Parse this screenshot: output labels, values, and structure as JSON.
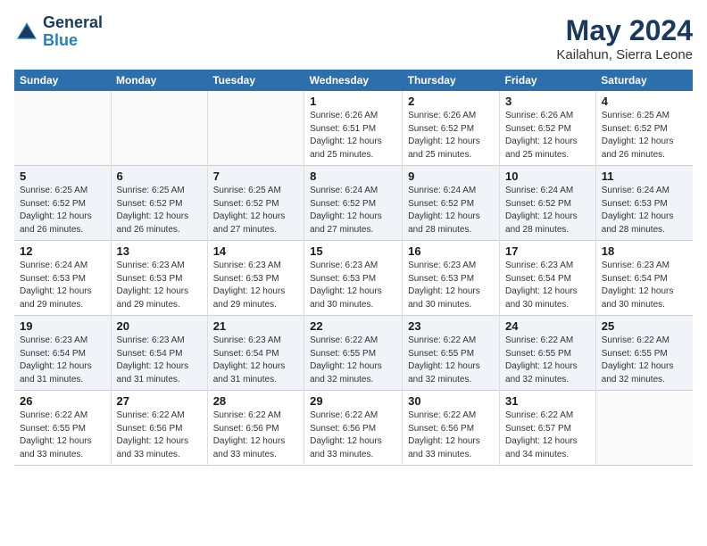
{
  "header": {
    "logo_line1": "General",
    "logo_line2": "Blue",
    "month": "May 2024",
    "location": "Kailahun, Sierra Leone"
  },
  "weekdays": [
    "Sunday",
    "Monday",
    "Tuesday",
    "Wednesday",
    "Thursday",
    "Friday",
    "Saturday"
  ],
  "weeks": [
    [
      {
        "day": "",
        "sunrise": "",
        "sunset": "",
        "daylight": ""
      },
      {
        "day": "",
        "sunrise": "",
        "sunset": "",
        "daylight": ""
      },
      {
        "day": "",
        "sunrise": "",
        "sunset": "",
        "daylight": ""
      },
      {
        "day": "1",
        "sunrise": "Sunrise: 6:26 AM",
        "sunset": "Sunset: 6:51 PM",
        "daylight": "Daylight: 12 hours and 25 minutes."
      },
      {
        "day": "2",
        "sunrise": "Sunrise: 6:26 AM",
        "sunset": "Sunset: 6:52 PM",
        "daylight": "Daylight: 12 hours and 25 minutes."
      },
      {
        "day": "3",
        "sunrise": "Sunrise: 6:26 AM",
        "sunset": "Sunset: 6:52 PM",
        "daylight": "Daylight: 12 hours and 25 minutes."
      },
      {
        "day": "4",
        "sunrise": "Sunrise: 6:25 AM",
        "sunset": "Sunset: 6:52 PM",
        "daylight": "Daylight: 12 hours and 26 minutes."
      }
    ],
    [
      {
        "day": "5",
        "sunrise": "Sunrise: 6:25 AM",
        "sunset": "Sunset: 6:52 PM",
        "daylight": "Daylight: 12 hours and 26 minutes."
      },
      {
        "day": "6",
        "sunrise": "Sunrise: 6:25 AM",
        "sunset": "Sunset: 6:52 PM",
        "daylight": "Daylight: 12 hours and 26 minutes."
      },
      {
        "day": "7",
        "sunrise": "Sunrise: 6:25 AM",
        "sunset": "Sunset: 6:52 PM",
        "daylight": "Daylight: 12 hours and 27 minutes."
      },
      {
        "day": "8",
        "sunrise": "Sunrise: 6:24 AM",
        "sunset": "Sunset: 6:52 PM",
        "daylight": "Daylight: 12 hours and 27 minutes."
      },
      {
        "day": "9",
        "sunrise": "Sunrise: 6:24 AM",
        "sunset": "Sunset: 6:52 PM",
        "daylight": "Daylight: 12 hours and 28 minutes."
      },
      {
        "day": "10",
        "sunrise": "Sunrise: 6:24 AM",
        "sunset": "Sunset: 6:52 PM",
        "daylight": "Daylight: 12 hours and 28 minutes."
      },
      {
        "day": "11",
        "sunrise": "Sunrise: 6:24 AM",
        "sunset": "Sunset: 6:53 PM",
        "daylight": "Daylight: 12 hours and 28 minutes."
      }
    ],
    [
      {
        "day": "12",
        "sunrise": "Sunrise: 6:24 AM",
        "sunset": "Sunset: 6:53 PM",
        "daylight": "Daylight: 12 hours and 29 minutes."
      },
      {
        "day": "13",
        "sunrise": "Sunrise: 6:23 AM",
        "sunset": "Sunset: 6:53 PM",
        "daylight": "Daylight: 12 hours and 29 minutes."
      },
      {
        "day": "14",
        "sunrise": "Sunrise: 6:23 AM",
        "sunset": "Sunset: 6:53 PM",
        "daylight": "Daylight: 12 hours and 29 minutes."
      },
      {
        "day": "15",
        "sunrise": "Sunrise: 6:23 AM",
        "sunset": "Sunset: 6:53 PM",
        "daylight": "Daylight: 12 hours and 30 minutes."
      },
      {
        "day": "16",
        "sunrise": "Sunrise: 6:23 AM",
        "sunset": "Sunset: 6:53 PM",
        "daylight": "Daylight: 12 hours and 30 minutes."
      },
      {
        "day": "17",
        "sunrise": "Sunrise: 6:23 AM",
        "sunset": "Sunset: 6:54 PM",
        "daylight": "Daylight: 12 hours and 30 minutes."
      },
      {
        "day": "18",
        "sunrise": "Sunrise: 6:23 AM",
        "sunset": "Sunset: 6:54 PM",
        "daylight": "Daylight: 12 hours and 30 minutes."
      }
    ],
    [
      {
        "day": "19",
        "sunrise": "Sunrise: 6:23 AM",
        "sunset": "Sunset: 6:54 PM",
        "daylight": "Daylight: 12 hours and 31 minutes."
      },
      {
        "day": "20",
        "sunrise": "Sunrise: 6:23 AM",
        "sunset": "Sunset: 6:54 PM",
        "daylight": "Daylight: 12 hours and 31 minutes."
      },
      {
        "day": "21",
        "sunrise": "Sunrise: 6:23 AM",
        "sunset": "Sunset: 6:54 PM",
        "daylight": "Daylight: 12 hours and 31 minutes."
      },
      {
        "day": "22",
        "sunrise": "Sunrise: 6:22 AM",
        "sunset": "Sunset: 6:55 PM",
        "daylight": "Daylight: 12 hours and 32 minutes."
      },
      {
        "day": "23",
        "sunrise": "Sunrise: 6:22 AM",
        "sunset": "Sunset: 6:55 PM",
        "daylight": "Daylight: 12 hours and 32 minutes."
      },
      {
        "day": "24",
        "sunrise": "Sunrise: 6:22 AM",
        "sunset": "Sunset: 6:55 PM",
        "daylight": "Daylight: 12 hours and 32 minutes."
      },
      {
        "day": "25",
        "sunrise": "Sunrise: 6:22 AM",
        "sunset": "Sunset: 6:55 PM",
        "daylight": "Daylight: 12 hours and 32 minutes."
      }
    ],
    [
      {
        "day": "26",
        "sunrise": "Sunrise: 6:22 AM",
        "sunset": "Sunset: 6:55 PM",
        "daylight": "Daylight: 12 hours and 33 minutes."
      },
      {
        "day": "27",
        "sunrise": "Sunrise: 6:22 AM",
        "sunset": "Sunset: 6:56 PM",
        "daylight": "Daylight: 12 hours and 33 minutes."
      },
      {
        "day": "28",
        "sunrise": "Sunrise: 6:22 AM",
        "sunset": "Sunset: 6:56 PM",
        "daylight": "Daylight: 12 hours and 33 minutes."
      },
      {
        "day": "29",
        "sunrise": "Sunrise: 6:22 AM",
        "sunset": "Sunset: 6:56 PM",
        "daylight": "Daylight: 12 hours and 33 minutes."
      },
      {
        "day": "30",
        "sunrise": "Sunrise: 6:22 AM",
        "sunset": "Sunset: 6:56 PM",
        "daylight": "Daylight: 12 hours and 33 minutes."
      },
      {
        "day": "31",
        "sunrise": "Sunrise: 6:22 AM",
        "sunset": "Sunset: 6:57 PM",
        "daylight": "Daylight: 12 hours and 34 minutes."
      },
      {
        "day": "",
        "sunrise": "",
        "sunset": "",
        "daylight": ""
      }
    ]
  ]
}
